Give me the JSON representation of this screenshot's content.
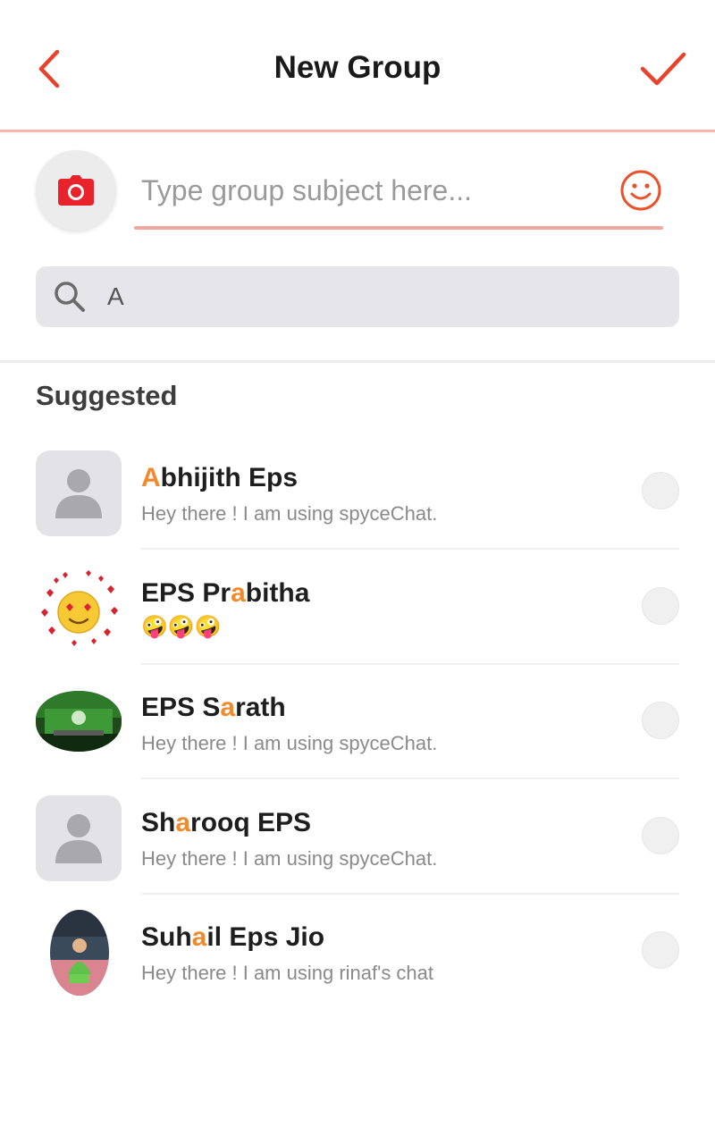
{
  "header": {
    "title": "New Group"
  },
  "subject": {
    "placeholder": "Type group subject here..."
  },
  "search": {
    "query": "A"
  },
  "suggested": {
    "title": "Suggested"
  },
  "contacts": [
    {
      "name_before": "",
      "name_highlight": "A",
      "name_after": "bhijith Eps",
      "status": "Hey there ! I am using spyceChat.",
      "avatar": "default-avatar"
    },
    {
      "name_before": "EPS Pr",
      "name_highlight": "a",
      "name_after": "bitha",
      "status": "🤪🤪🤪",
      "avatar": "heart-eyes-emoji-photo"
    },
    {
      "name_before": "EPS S",
      "name_highlight": "a",
      "name_after": "rath",
      "status": "Hey there ! I am using spyceChat.",
      "avatar": "green-photo"
    },
    {
      "name_before": "Sh",
      "name_highlight": "a",
      "name_after": "rooq EPS",
      "status": "Hey there ! I am using spyceChat.",
      "avatar": "default-avatar"
    },
    {
      "name_before": "Suh",
      "name_highlight": "a",
      "name_after": "il Eps Jio",
      "status": "Hey there ! I am using rinaf's chat",
      "avatar": "portrait-photo"
    }
  ],
  "colors": {
    "accent": "#e8412c",
    "highlight": "#f08a2c",
    "divider": "#f6b8ae",
    "search_bg": "#e6e6ea"
  }
}
